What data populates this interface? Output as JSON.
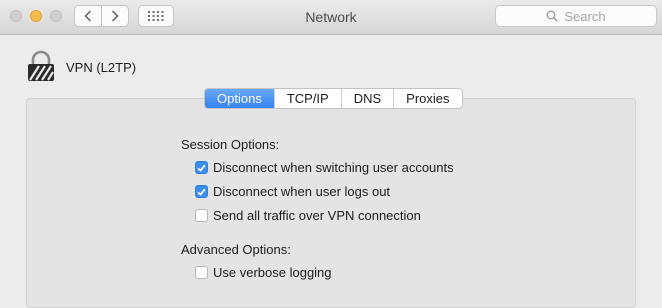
{
  "window": {
    "title": "Network"
  },
  "search": {
    "placeholder": "Search"
  },
  "service": {
    "name": "VPN (L2TP)"
  },
  "tabs": [
    {
      "label": "Options",
      "active": true
    },
    {
      "label": "TCP/IP",
      "active": false
    },
    {
      "label": "DNS",
      "active": false
    },
    {
      "label": "Proxies",
      "active": false
    }
  ],
  "session": {
    "label": "Session Options:",
    "options": [
      {
        "label": "Disconnect when switching user accounts",
        "checked": true
      },
      {
        "label": "Disconnect when user logs out",
        "checked": true
      },
      {
        "label": "Send all traffic over VPN connection",
        "checked": false
      }
    ]
  },
  "advanced": {
    "label": "Advanced Options:",
    "options": [
      {
        "label": "Use verbose logging",
        "checked": false
      }
    ]
  },
  "colors": {
    "accent": "#3b8ff2",
    "minimize": "#f5bf4f"
  },
  "icons": [
    "back-icon",
    "forward-icon",
    "grid-icon",
    "search-icon",
    "vpn-lock-icon",
    "checkmark-icon"
  ]
}
